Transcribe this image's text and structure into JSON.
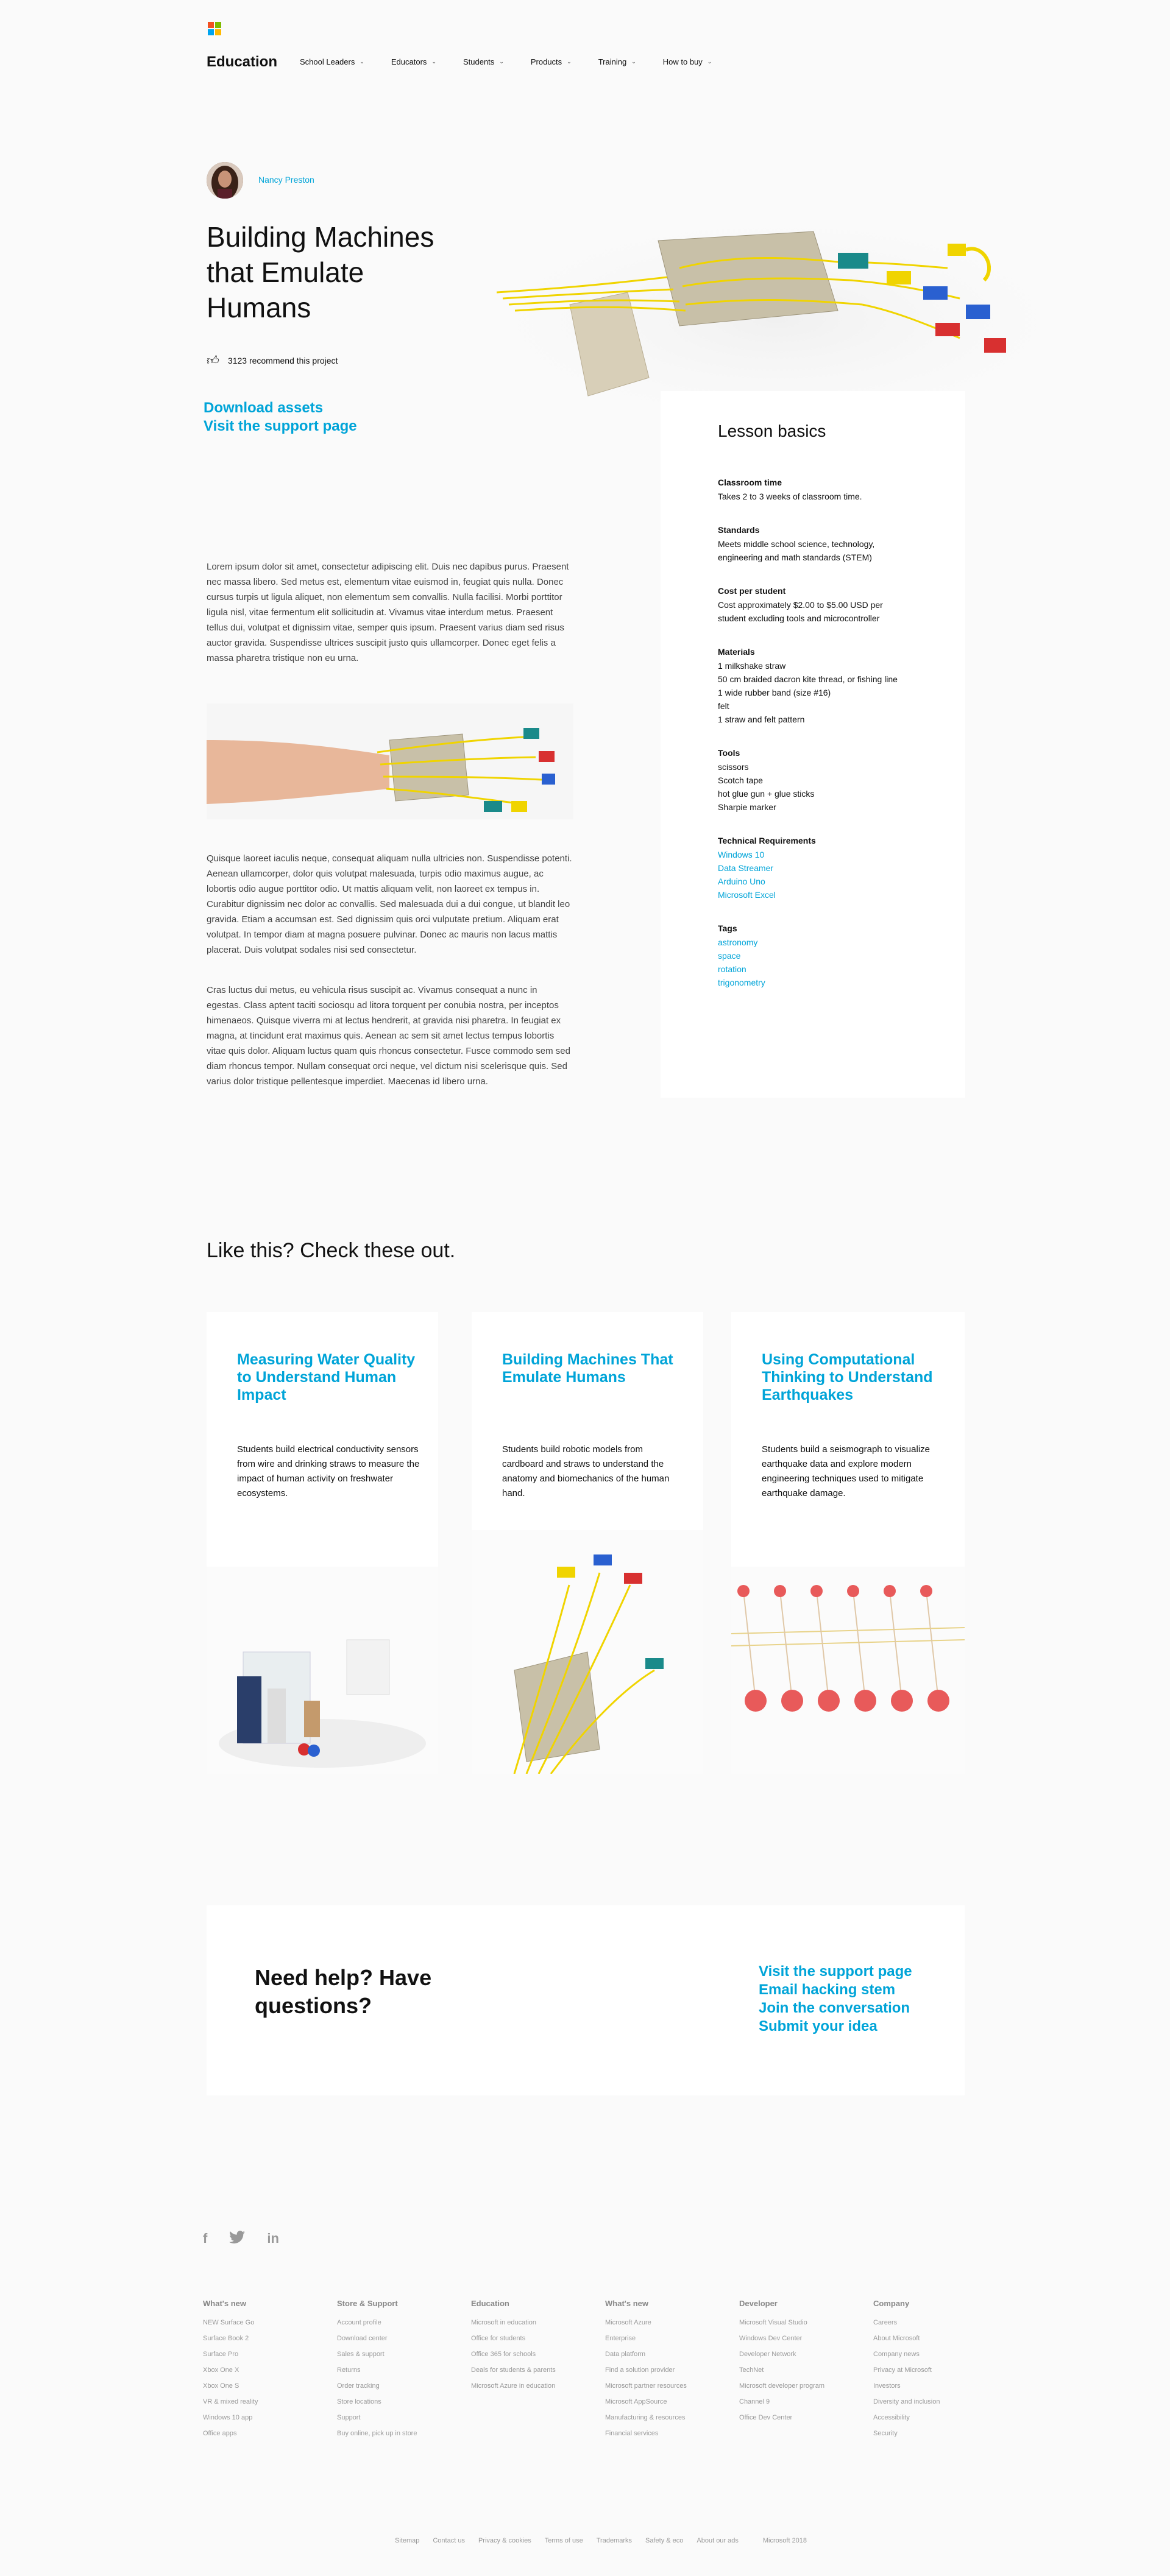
{
  "header": {
    "brand": "Education",
    "logo_colors": [
      "#f25022",
      "#7fba00",
      "#00a4ef",
      "#ffb900"
    ],
    "nav": [
      "School Leaders",
      "Educators",
      "Students",
      "Products",
      "Training",
      "How to buy"
    ]
  },
  "hero": {
    "author": "Nancy Preston",
    "title": "Building Machines that Emulate Humans",
    "recommend": "3123 recommend this project",
    "links": [
      "Download assets",
      "Visit the support page"
    ]
  },
  "lesson": {
    "heading": "Lesson basics",
    "classroom_time": {
      "label": "Classroom time",
      "value": "Takes 2 to 3 weeks of classroom time."
    },
    "standards": {
      "label": "Standards",
      "value": "Meets middle school science, technology, engineering and math standards (STEM)"
    },
    "cost": {
      "label": "Cost per student",
      "value": "Cost approximately $2.00 to $5.00 USD per student excluding tools and microcontroller"
    },
    "materials": {
      "label": "Materials",
      "items": [
        "1 milkshake straw",
        "50 cm braided dacron kite thread, or fishing line",
        "1 wide rubber band (size #16)",
        "felt",
        "1 straw and felt pattern"
      ]
    },
    "tools": {
      "label": "Tools",
      "items": [
        "scissors",
        "Scotch tape",
        "hot glue gun + glue sticks",
        "Sharpie marker"
      ]
    },
    "tech": {
      "label": "Technical Requirements",
      "items": [
        "Windows 10",
        "Data Streamer",
        "Arduino Uno",
        "Microsoft Excel"
      ]
    },
    "tags": {
      "label": "Tags",
      "items": [
        "astronomy",
        "space",
        "rotation",
        "trigonometry"
      ]
    }
  },
  "body": {
    "p1": "Lorem ipsum dolor sit amet, consectetur adipiscing elit. Duis nec dapibus purus. Praesent nec massa libero. Sed metus est, elementum vitae euismod in, feugiat quis nulla. Donec cursus turpis ut ligula aliquet, non elementum sem convallis. Nulla facilisi. Morbi porttitor ligula nisl, vitae fermentum elit sollicitudin at. Vivamus vitae interdum metus. Praesent tellus dui, volutpat et dignissim vitae, semper quis ipsum. Praesent varius diam sed risus auctor gravida. Suspendisse ultrices suscipit justo quis ullamcorper. Donec eget felis a massa pharetra tristique non eu urna.",
    "p2": "Quisque laoreet iaculis neque, consequat aliquam nulla ultricies non. Suspendisse potenti. Aenean ullamcorper, dolor quis volutpat malesuada, turpis odio maximus augue, ac lobortis odio augue porttitor odio. Ut mattis aliquam velit, non laoreet ex tempus in. Curabitur dignissim nec dolor ac convallis. Sed malesuada dui a dui congue, ut blandit leo gravida. Etiam a accumsan est. Sed dignissim quis orci vulputate pretium. Aliquam erat volutpat. In tempor diam at magna posuere pulvinar. Donec ac mauris non lacus mattis placerat. Duis volutpat sodales nisi sed consectetur.",
    "p3": "Cras luctus dui metus, eu vehicula risus suscipit ac. Vivamus consequat a nunc in egestas. Class aptent taciti sociosqu ad litora torquent per conubia nostra, per inceptos himenaeos. Quisque viverra mi at lectus hendrerit, at gravida nisi pharetra. In feugiat ex magna, at tincidunt erat maximus quis. Aenean ac sem sit amet lectus tempus lobortis vitae quis dolor. Aliquam luctus quam quis rhoncus consectetur. Fusce commodo sem sed diam rhoncus tempor. Nullam consequat orci neque, vel dictum nisi scelerisque quis. Sed varius dolor tristique pellentesque imperdiet. Maecenas id libero urna."
  },
  "related": {
    "title": "Like this? Check these out.",
    "cards": [
      {
        "title": "Measuring Water Quality to Understand Human Impact",
        "desc": "Students build electrical conductivity sensors from wire and drinking straws to measure the impact of human activity on freshwater ecosystems."
      },
      {
        "title": "Building Machines That Emulate Humans",
        "desc": "Students build robotic models from cardboard and straws to understand the anatomy and biomechanics of the human hand."
      },
      {
        "title": "Using Computational Thinking to Understand Earthquakes",
        "desc": "Students build a seismograph to visualize earthquake data and explore modern engineering techniques used to mitigate earthquake damage."
      }
    ]
  },
  "help": {
    "title": "Need help? Have questions?",
    "links": [
      "Visit the support page",
      "Email hacking stem",
      "Join the conversation",
      "Submit your idea"
    ]
  },
  "footer": {
    "social": [
      "f",
      "twitter-icon",
      "in"
    ],
    "columns": [
      {
        "title": "What's new",
        "items": [
          "NEW Surface Go",
          "Surface Book 2",
          "Surface Pro",
          "Xbox One X",
          "Xbox One S",
          "VR & mixed reality",
          "Windows 10 app",
          "Office apps"
        ]
      },
      {
        "title": "Store & Support",
        "items": [
          "Account profile",
          "Download center",
          "Sales & support",
          "Returns",
          "Order tracking",
          "Store locations",
          "Support",
          "Buy online, pick up in store"
        ]
      },
      {
        "title": "Education",
        "items": [
          "Microsoft in education",
          "Office for students",
          "Office 365 for schools",
          "Deals for students & parents",
          "Microsoft Azure in education"
        ]
      },
      {
        "title": "What's new",
        "items": [
          "Microsoft Azure",
          "Enterprise",
          "Data platform",
          "Find a solution provider",
          "Microsoft partner resources",
          "Microsoft AppSource",
          "Manufacturing & resources",
          "Financial services"
        ]
      },
      {
        "title": "Developer",
        "items": [
          "Microsoft Visual Studio",
          "Windows Dev Center",
          "Developer Network",
          "TechNet",
          "Microsoft developer program",
          "Channel 9",
          "Office Dev Center"
        ]
      },
      {
        "title": "Company",
        "items": [
          "Careers",
          "About Microsoft",
          "Company news",
          "Privacy at Microsoft",
          "Investors",
          "Diversity and inclusion",
          "Accessibility",
          "Security"
        ]
      }
    ],
    "bottom": [
      "Sitemap",
      "Contact us",
      "Privacy & cookies",
      "Terms of use",
      "Trademarks",
      "Safety & eco",
      "About our ads",
      "Microsoft 2018"
    ]
  }
}
